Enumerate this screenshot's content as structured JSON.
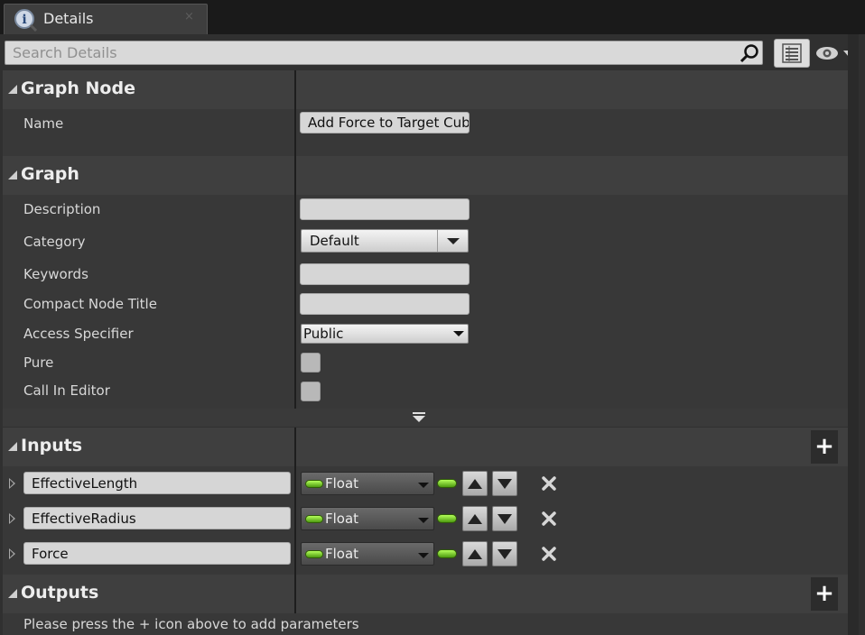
{
  "tab": {
    "title": "Details",
    "close_glyph": "×"
  },
  "search": {
    "placeholder": "Search Details",
    "value": ""
  },
  "icons": {
    "search": "search-icon",
    "view_options": "view-options-icon",
    "visibility": "eye-icon",
    "info": "info-icon"
  },
  "sections": {
    "graph_node": {
      "title": "Graph Node",
      "name_label": "Name",
      "name_value": "Add Force to Target Cube"
    },
    "graph": {
      "title": "Graph",
      "description_label": "Description",
      "description_value": "",
      "category_label": "Category",
      "category_value": "Default",
      "keywords_label": "Keywords",
      "keywords_value": "",
      "compact_label": "Compact Node Title",
      "compact_value": "",
      "access_label": "Access Specifier",
      "access_value": "Public",
      "pure_label": "Pure",
      "pure_checked": false,
      "call_label": "Call In Editor",
      "call_checked": false
    },
    "inputs": {
      "title": "Inputs",
      "add_glyph": "+",
      "items": [
        {
          "name": "EffectiveLength",
          "type": "Float"
        },
        {
          "name": "EffectiveRadius",
          "type": "Float"
        },
        {
          "name": "Force",
          "type": "Float"
        }
      ]
    },
    "outputs": {
      "title": "Outputs",
      "add_glyph": "+",
      "hint": "Please press the + icon above to add parameters"
    }
  },
  "colors": {
    "float_pin": "#7ed321",
    "panel_bg": "#383838",
    "header_bg": "#3f3f3f"
  }
}
